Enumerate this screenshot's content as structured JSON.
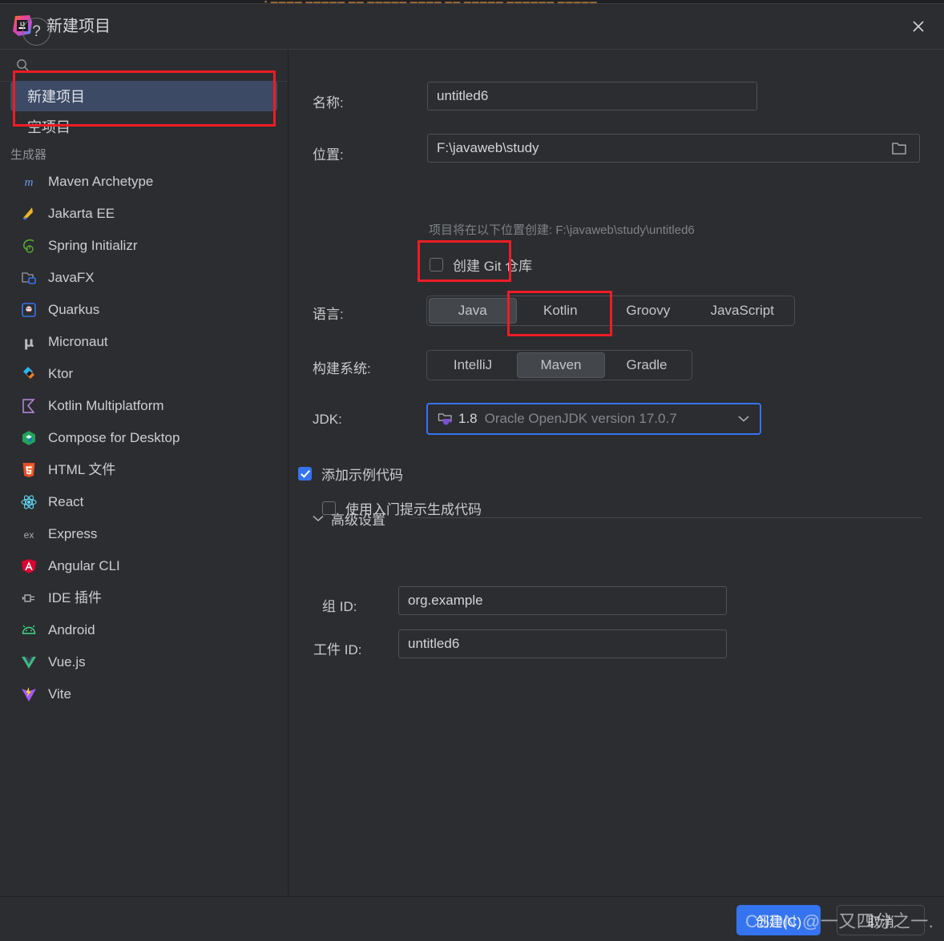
{
  "background_window": {
    "strip_text": "▪ ▬▬▬▬ ▬▬▬▬▬  ▬▬ ▬▬▬▬▬ ▬▬▬▬ ▬▬ ▬▬▬▬▬ ▬▬▬▬▬▬ ▬▬▬▬▬"
  },
  "titlebar": {
    "title": "新建项目",
    "logo_icon": "intellij-idea-logo",
    "close_icon": "close-icon"
  },
  "sidebar": {
    "search": {
      "placeholder": "",
      "value": "",
      "icon": "search-icon"
    },
    "project_types": [
      {
        "label": "新建项目",
        "selected": true
      },
      {
        "label": "空项目",
        "selected": false
      }
    ],
    "generators_header": "生成器",
    "generators": [
      {
        "label": "Maven Archetype",
        "icon": "maven-icon"
      },
      {
        "label": "Jakarta EE",
        "icon": "jakarta-ee-icon"
      },
      {
        "label": "Spring Initializr",
        "icon": "spring-icon"
      },
      {
        "label": "JavaFX",
        "icon": "javafx-icon"
      },
      {
        "label": "Quarkus",
        "icon": "quarkus-icon"
      },
      {
        "label": "Micronaut",
        "icon": "micronaut-icon"
      },
      {
        "label": "Ktor",
        "icon": "ktor-icon"
      },
      {
        "label": "Kotlin Multiplatform",
        "icon": "kotlin-multiplatform-icon"
      },
      {
        "label": "Compose for Desktop",
        "icon": "compose-icon"
      },
      {
        "label": "HTML 文件",
        "icon": "html5-icon"
      },
      {
        "label": "React",
        "icon": "react-icon"
      },
      {
        "label": "Express",
        "icon": "express-icon"
      },
      {
        "label": "Angular CLI",
        "icon": "angular-icon"
      },
      {
        "label": "IDE 插件",
        "icon": "plugin-icon"
      },
      {
        "label": "Android",
        "icon": "android-icon"
      },
      {
        "label": "Vue.js",
        "icon": "vue-icon"
      },
      {
        "label": "Vite",
        "icon": "vite-icon"
      }
    ]
  },
  "form": {
    "name_label": "名称:",
    "name_value": "untitled6",
    "location_label": "位置:",
    "location_value": "F:\\javaweb\\study",
    "location_browse_icon": "folder-icon",
    "location_hint": "项目将在以下位置创建: F:\\javaweb\\study\\untitled6",
    "git_checkbox_label": "创建 Git 仓库",
    "git_checked": false,
    "language_label": "语言:",
    "languages": [
      "Java",
      "Kotlin",
      "Groovy",
      "JavaScript"
    ],
    "language_selected": "Java",
    "language_add_icon": "plus-icon",
    "build_system_label": "构建系统:",
    "build_systems": [
      "IntelliJ",
      "Maven",
      "Gradle"
    ],
    "build_system_selected": "Maven",
    "jdk_label": "JDK:",
    "jdk_version": "1.8",
    "jdk_description": "Oracle OpenJDK version 17.0.7",
    "jdk_icon": "jdk-folder-icon",
    "jdk_chevron_icon": "chevron-down-icon",
    "sample_code_label": "添加示例代码",
    "sample_code_checked": true,
    "onboarding_label": "使用入门提示生成代码",
    "onboarding_checked": false,
    "advanced_title": "高级设置",
    "advanced_chevron_icon": "chevron-down-icon",
    "group_id_label": "组 ID:",
    "group_id_value": "org.example",
    "artifact_id_label": "工件 ID:",
    "artifact_id_value": "untitled6"
  },
  "footer": {
    "help_label": "?",
    "help_icon": "help-icon",
    "create_label": "创建(C)",
    "cancel_label": "取消"
  },
  "watermark": {
    "text": "CSDN @一又四分之一."
  },
  "colors": {
    "dialog_bg": "#2b2d30",
    "selection_blue": "#3d4a66",
    "accent_blue": "#3574f0",
    "annotation_red": "#ee1c25",
    "text_primary": "#c9cacc",
    "text_muted": "#83868c"
  }
}
